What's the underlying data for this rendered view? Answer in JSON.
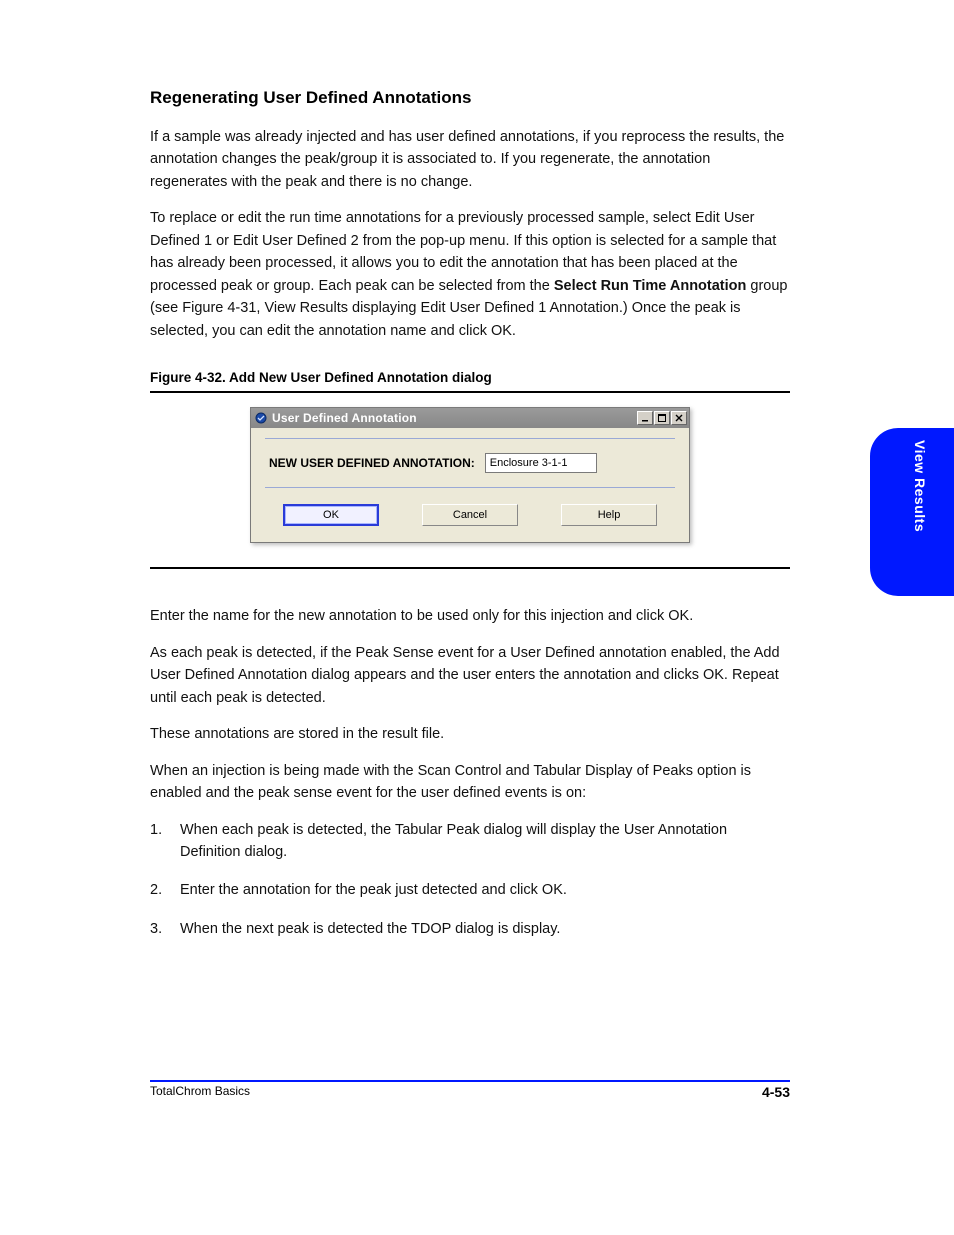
{
  "heading": "Regenerating User Defined Annotations",
  "intro_text": "If a sample was already injected and has user defined annotations, if you reprocess the results, the annotation changes the peak/group it is associated to. If you regenerate, the annotation regenerates with the peak and there is no change.",
  "replace_text_1": "To replace or edit the run time annotations for a previously processed sample, select Edit User Defined 1 or Edit User Defined 2 from the pop-up menu. If this option is selected for a sample that has already been processed, it allows you to edit the annotation that has been placed at the processed peak or group. Each peak can be selected from the ",
  "replace_text_bold": "Select Run Time Annotation",
  "replace_text_2": " group (see Figure 4-31, View Results displaying Edit User Defined 1 Annotation.) Once the peak is selected, you can edit the annotation name and click OK.",
  "figure_label": "Figure 4-32.  Add New User Defined Annotation dialog",
  "dialog": {
    "title": "User Defined Annotation",
    "prompt_label": "NEW USER DEFINED ANNOTATION:",
    "input_value": "Enclosure 3-1-1",
    "ok": "OK",
    "cancel": "Cancel",
    "help": "Help"
  },
  "after_paras": [
    "Enter the name for the new annotation to be used only for this injection and click OK.",
    "As each peak is detected, if the Peak Sense event for a User Defined annotation enabled, the Add User Defined Annotation dialog appears and the user enters the annotation and clicks OK. Repeat until each peak is detected.",
    "These annotations are stored in the result file.",
    "When an injection is being made with the Scan Control and Tabular Display of Peaks option is enabled and the peak sense event for the user defined events is on:"
  ],
  "steps": [
    {
      "num": "1.",
      "text": "When each peak is detected, the Tabular Peak dialog will display the User Annotation Definition dialog."
    },
    {
      "num": "2.",
      "text": "Enter the annotation for the peak just detected and click OK."
    },
    {
      "num": "3.",
      "text": "When the next peak is detected the TDOP dialog is display."
    }
  ],
  "side_tab": "View Results",
  "footer_left": "TotalChrom Basics",
  "footer_page": "4-53",
  "footer_ref": ""
}
